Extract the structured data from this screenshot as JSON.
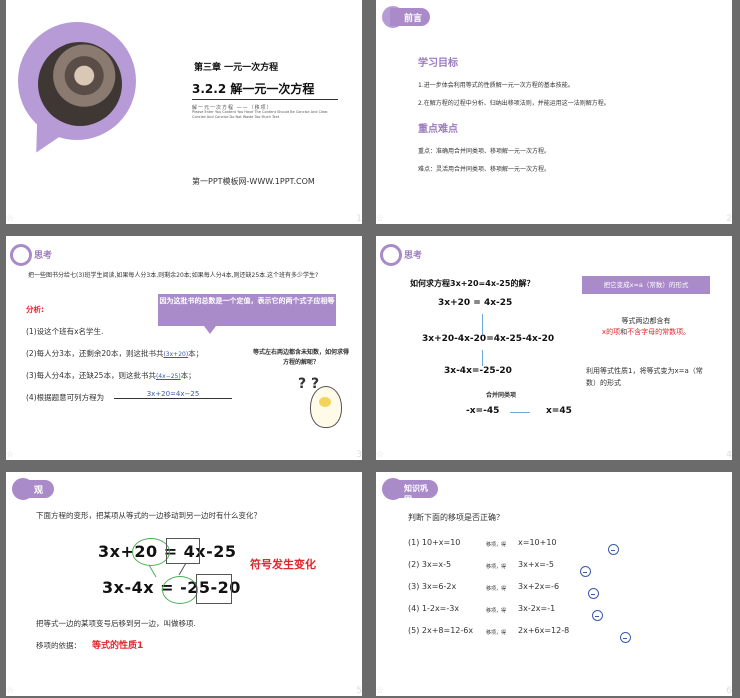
{
  "slides": [
    {
      "number": "1",
      "chapter": "第三章 一元一次方程",
      "title": "3.2.2 解一元一次方程",
      "english": "Please Enter You Content You Have The Content Should Be Concise And Clear. Concise And Concise Do Not Waste Too Much Text",
      "subtitle": "解一元一次方程  ——（移项）",
      "site": "第一PPT模板网-WWW.1PPT.COM"
    },
    {
      "number": "2",
      "tag": "前言",
      "goals_heading": "学习目标",
      "goals": [
        "1.进一步体会利用等式的性质解一元一次方程的基本技能。",
        "2.在解方程的过程中分析、归纳出移项法则，并能运用这一法则解方程。"
      ],
      "keys_heading": "重点难点",
      "keys": [
        "重点：准确用合并同类项、移项解一元一次方程。",
        "难点：灵活用合并同类项、移项解一元一次方程。"
      ]
    },
    {
      "number": "3",
      "tag": "思考",
      "problem": "把一些图书分给七(3)班学生阅读,如果每人分3本,则剩余20本;如果每人分4本,则还缺25本.这个班有多少学生?",
      "analysis_label": "分析:",
      "steps": [
        "(1)设这个班有x名学生.",
        "(2)每人分3本，还剩余20本，则这批书共",
        "(3)每人分4本，还缺25本，则这批书共",
        "(4)根据题意可列方程为"
      ],
      "fill_2": "(3x+20)",
      "fill_2_tail": "本；",
      "fill_3": "(4x−25)",
      "fill_3_tail": "本；",
      "fill_4": "3x+20=4x−25",
      "callout": "因为这批书的总数是一个定值，表示它的两个式子应相等",
      "question": "等式左右两边都含未知数，如何求得方程的解呢？",
      "mascot_marks": "? ?"
    },
    {
      "number": "4",
      "tag": "思考",
      "question": "如何求方程3x+20=4x-25的解？",
      "eq1": "3x+20 = 4x-25",
      "eq2": "3x+20-4x-20=4x-25-4x-20",
      "eq3": "3x-4x=-25-20",
      "merge_label": "合并同类项",
      "eq4_left": "-x=-45",
      "eq4_right": "x=45",
      "goal_box": "把它变成x=a（常数）的形式",
      "note1_a": "等式两边都含有",
      "note1_b": "x的项",
      "note1_c": "和",
      "note1_d": "不含字母的常数项",
      "note1_e": "。",
      "note2": "利用等式性质1，将等式变为x=a（常数）的形式"
    },
    {
      "number": "5",
      "tag": "观察",
      "question": "下面方程的变形，把某项从等式的一边移动到另一边时有什么变化？",
      "eq_top": "3x+20 = 4x-25",
      "eq_bottom": "3x-4x = -25-20",
      "sign_change": "符号发生变化",
      "definition": "把等式一边的某项变号后移到另一边，叫做移项.",
      "basis_label": "移项的依据：",
      "basis_value": "等式的性质1"
    },
    {
      "number": "6",
      "tag": "知识巩固",
      "question": "判断下面的移项是否正确？",
      "items": [
        {
          "eq": "(1)  10+x=10",
          "mid": "移项，得",
          "res": "x=10+10",
          "face": "frown-icon"
        },
        {
          "eq": "(2)  3x=x-5",
          "mid": "移项，得",
          "res": "3x+x=-5",
          "face": "frown-icon"
        },
        {
          "eq": "(3)  3x=6-2x",
          "mid": "移项，得",
          "res": "3x+2x=-6",
          "face": "frown-icon"
        },
        {
          "eq": "(4)  1-2x=-3x",
          "mid": "移项，得",
          "res": "3x-2x=-1",
          "face": "frown-icon"
        },
        {
          "eq": "(5)  2x+8=12-6x",
          "mid": "移项，得",
          "res": "2x+6x=12-8",
          "face": "smile-icon"
        }
      ]
    }
  ],
  "bar_star": "☆",
  "colors": {
    "purple": "#a98bc9",
    "red": "#e0272b",
    "blue": "#3b5aa8"
  }
}
